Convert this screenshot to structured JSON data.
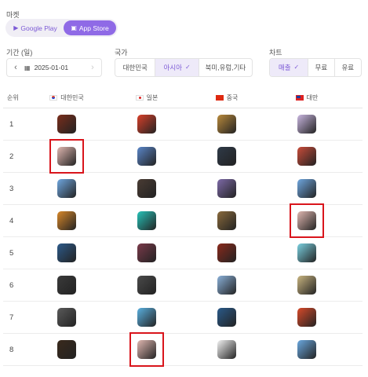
{
  "filters": {
    "market_label": "마켓",
    "market_options": [
      {
        "label": "Google Play",
        "icon": "play-icon",
        "active": false
      },
      {
        "label": "App Store",
        "icon": "appstore-icon",
        "active": true
      }
    ],
    "period_label": "기간 (일)",
    "date_value": "2025-01-01",
    "country_label": "국가",
    "country_options": [
      {
        "label": "대한민국",
        "active": false
      },
      {
        "label": "아시아",
        "active": true
      },
      {
        "label": "북미,유럽,기타",
        "active": false
      }
    ],
    "chart_label": "차트",
    "chart_options": [
      {
        "label": "매출",
        "active": true
      },
      {
        "label": "무료",
        "active": false
      },
      {
        "label": "유료",
        "active": false
      }
    ]
  },
  "table": {
    "rank_header": "순위",
    "columns": [
      {
        "label": "대한민국",
        "flag": "kr"
      },
      {
        "label": "일본",
        "flag": "jp"
      },
      {
        "label": "중국",
        "flag": "cn"
      },
      {
        "label": "대만",
        "flag": "tw"
      }
    ],
    "rows": [
      {
        "rank": "1",
        "apps": [
          {
            "color": "#7a2e1c"
          },
          {
            "color": "#d8402a"
          },
          {
            "color": "#b98a3c"
          },
          {
            "color": "#c9b6e0"
          }
        ]
      },
      {
        "rank": "2",
        "apps": [
          {
            "color": "#e0b7b0"
          },
          {
            "color": "#5a86c8"
          },
          {
            "color": "#2f3a48"
          },
          {
            "color": "#c94c3a"
          }
        ]
      },
      {
        "rank": "3",
        "apps": [
          {
            "color": "#6fa7e0"
          },
          {
            "color": "#4a3c34"
          },
          {
            "color": "#7e6aa8"
          },
          {
            "color": "#6fa7e0"
          }
        ]
      },
      {
        "rank": "4",
        "apps": [
          {
            "color": "#d8882a"
          },
          {
            "color": "#26c2b8"
          },
          {
            "color": "#8a6a3c"
          },
          {
            "color": "#e0b7b0"
          }
        ]
      },
      {
        "rank": "5",
        "apps": [
          {
            "color": "#2d5a8a"
          },
          {
            "color": "#7a3a4a"
          },
          {
            "color": "#8a2a1c"
          },
          {
            "color": "#7ad0e0"
          }
        ]
      },
      {
        "rank": "6",
        "apps": [
          {
            "color": "#3a3a3a"
          },
          {
            "color": "#4a4a4a"
          },
          {
            "color": "#8ab0d8"
          },
          {
            "color": "#c8b480"
          }
        ]
      },
      {
        "rank": "7",
        "apps": [
          {
            "color": "#5a5a5a"
          },
          {
            "color": "#5ab0e0"
          },
          {
            "color": "#2a5a8a"
          },
          {
            "color": "#d84a2a"
          }
        ]
      },
      {
        "rank": "8",
        "apps": [
          {
            "color": "#3a2a1c"
          },
          {
            "color": "#e0b7b0"
          },
          {
            "color": "#f2f2f2"
          },
          {
            "color": "#6aa8e0"
          }
        ]
      }
    ],
    "highlights": [
      {
        "row": 2,
        "col": 1
      },
      {
        "row": 4,
        "col": 4
      },
      {
        "row": 8,
        "col": 2
      }
    ]
  }
}
